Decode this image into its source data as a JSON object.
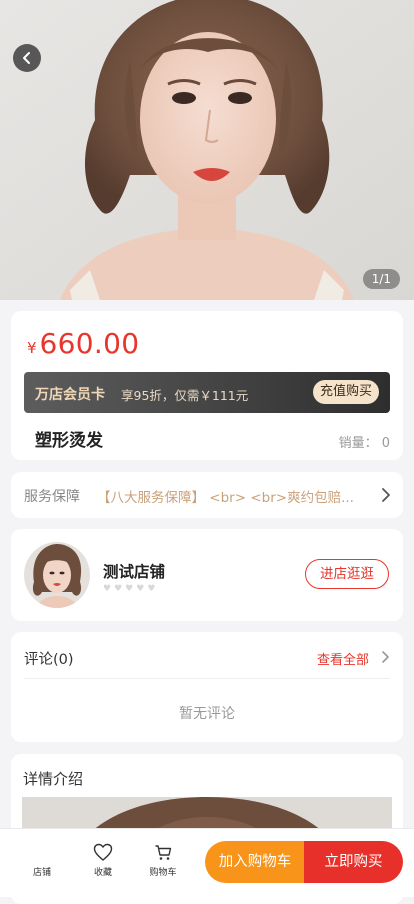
{
  "gallery": {
    "counter": "1/1"
  },
  "product": {
    "currency": "¥",
    "price": "660.00",
    "name": "塑形烫发",
    "sales": "销量： 0"
  },
  "vip": {
    "title": "万店会员卡",
    "description": "享95折，仅需￥111元",
    "button": "充值购买"
  },
  "service": {
    "label": "服务保障",
    "text": "【八大服务保障】 <br> <br>爽约包赔..."
  },
  "shop": {
    "name": "测试店铺",
    "rating_stars": 5,
    "enter_button": "进店逛逛"
  },
  "comments": {
    "title": "评论(0)",
    "view_all": "查看全部",
    "empty_text": "暂无评论"
  },
  "details": {
    "title": "详情介绍"
  },
  "bottom_bar": {
    "nav": [
      {
        "label": "店铺",
        "icon": "store-icon"
      },
      {
        "label": "收藏",
        "icon": "heart-icon"
      },
      {
        "label": "购物车",
        "icon": "cart-icon"
      }
    ],
    "add_to_cart": "加入购物车",
    "buy_now": "立即购买"
  },
  "colors": {
    "accent_red": "#e8362c",
    "cart_orange": "#f79419",
    "vip_gold": "#f0d7b5",
    "service_gold": "#c9a27a"
  }
}
